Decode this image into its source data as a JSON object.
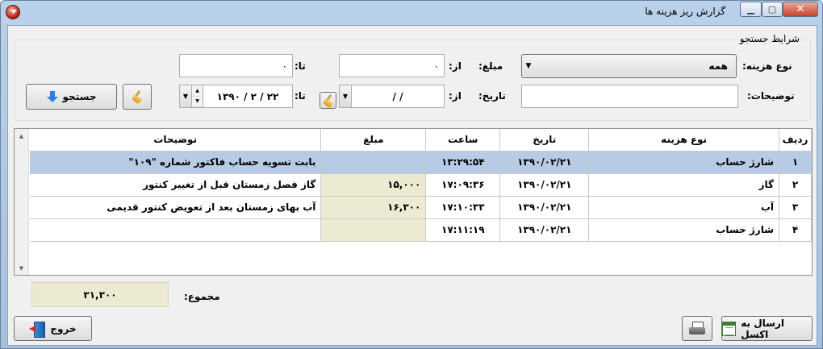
{
  "window": {
    "title": "گزارش ریز هزینه ها",
    "close_label": "✕",
    "min_label": "▭",
    "max_label": "▢"
  },
  "search": {
    "group_title": "شرایط جستجو",
    "expense_type_label": "نوع هزینه:",
    "expense_type_value": "همه",
    "amount_label": "مبلغ:",
    "from_label": "از:",
    "to_label": "تا:",
    "amount_from": "۰",
    "amount_to": "۰",
    "date_label": "تاریخ:",
    "date_from_value": "/        /",
    "date_to_value": "۱۳۹۰ / ۲ / ۲۲",
    "description_label": "توضیحات:",
    "description_value": "",
    "search_button": "جستجو"
  },
  "grid": {
    "columns": [
      "ردیف",
      "نوع هزینه",
      "تاریخ",
      "ساعت",
      "مبلغ",
      "توضیحات"
    ],
    "rows": [
      {
        "index": "۱",
        "type": "شارژ حساب",
        "date": "۱۳۹۰/۰۲/۲۱",
        "time": "۱۳:۲۹:۵۴",
        "amount": "",
        "description": "بابت تسویه حساب فاکتور شماره \"۱۰۹\""
      },
      {
        "index": "۲",
        "type": "گاز",
        "date": "۱۳۹۰/۰۲/۲۱",
        "time": "۱۷:۰۹:۳۶",
        "amount": "۱۵,۰۰۰",
        "description": "گاز فصل زمستان قبل از تغییر کنتور"
      },
      {
        "index": "۳",
        "type": "آب",
        "date": "۱۳۹۰/۰۲/۲۱",
        "time": "۱۷:۱۰:۳۳",
        "amount": "۱۶,۳۰۰",
        "description": "آب بهای زمستان بعد از تعویض کنتور قدیمی"
      },
      {
        "index": "۴",
        "type": "شارژ حساب",
        "date": "۱۳۹۰/۰۲/۲۱",
        "time": "۱۷:۱۱:۱۹",
        "amount": "",
        "description": ""
      }
    ]
  },
  "summary": {
    "total_label": "مجموع:",
    "total_value": "۳۱,۳۰۰"
  },
  "footer": {
    "exit_button": "خروج",
    "excel_button": "ارسال به اکسل"
  },
  "icons": [
    "app-icon",
    "broom-icon",
    "down-arrow-icon",
    "exit-icon",
    "printer-icon",
    "excel-icon"
  ]
}
